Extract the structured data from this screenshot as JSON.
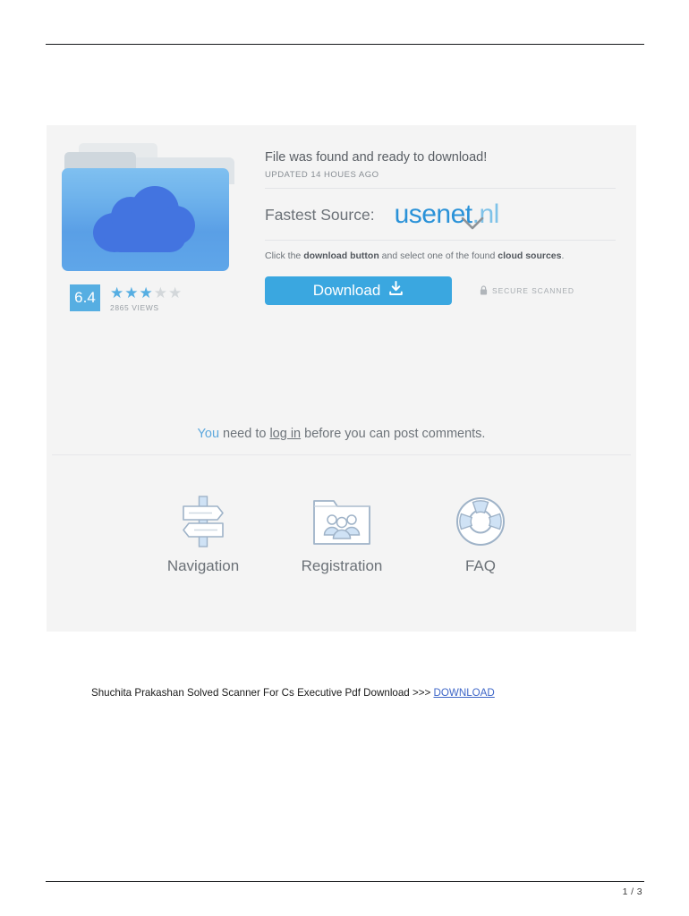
{
  "document": {
    "caption_text": "Shuchita Prakashan Solved Scanner For Cs Executive Pdf Download >>> ",
    "caption_link": "DOWNLOAD",
    "page_indicator": "1 / 3"
  },
  "ad_panel": {
    "headline": "File was found and ready to download!",
    "updated": "UPDATED 14 HOUES AGO",
    "source_label": "Fastest Source:",
    "logo": {
      "main": "usenet",
      "tld": ".nl"
    },
    "instruction": {
      "part1": "Click the ",
      "bold1": "download button",
      "part2": " and select one of the found ",
      "bold2": "cloud sources",
      "part3": "."
    },
    "download_button": "Download",
    "secure_badge": "SECURE SCANNED",
    "rating": {
      "score": "6.4",
      "stars_filled": 3,
      "stars_total": 5,
      "views": "2865 VIEWS"
    },
    "comments_notice": {
      "you": "You",
      "middle": " need to ",
      "link": "log in",
      "tail": " before you can post comments."
    },
    "tiles": [
      {
        "label": "Navigation",
        "icon": "signpost-icon"
      },
      {
        "label": "Registration",
        "icon": "folder-users-icon"
      },
      {
        "label": "FAQ",
        "icon": "life-ring-icon"
      }
    ]
  },
  "colors": {
    "accent_blue": "#3aa7e0",
    "logo_blue": "#2a92d8",
    "logo_light_blue": "#7fc2e8",
    "cloud_blue": "#4374e0",
    "panel_bg": "#f4f4f4",
    "link_blue": "#3f67c8"
  }
}
